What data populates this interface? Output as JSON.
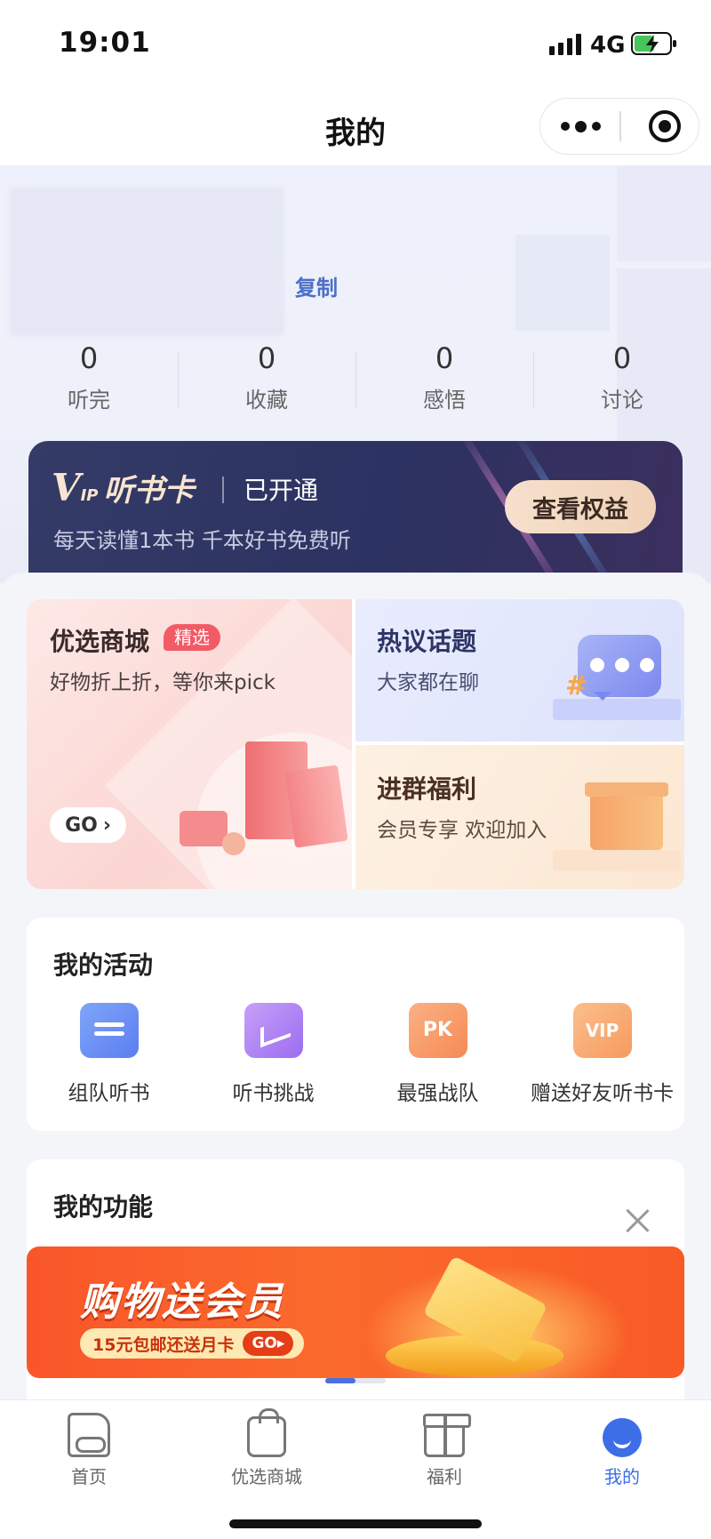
{
  "status_bar": {
    "time": "19:01",
    "network": "4G"
  },
  "nav": {
    "title": "我的"
  },
  "profile": {
    "copy_label": "复制",
    "stats": [
      {
        "value": "0",
        "label": "听完"
      },
      {
        "value": "0",
        "label": "收藏"
      },
      {
        "value": "0",
        "label": "感悟"
      },
      {
        "value": "0",
        "label": "讨论"
      }
    ]
  },
  "vip": {
    "logo_v": "V",
    "logo_ip": "IP",
    "title": "听书卡",
    "status": "已开通",
    "subtitle": "每天读懂1本书 千本好书免费听",
    "button": "查看权益"
  },
  "promos": {
    "mall": {
      "title": "优选商城",
      "badge": "精选",
      "subtitle": "好物折上折，等你来pick",
      "go": "GO"
    },
    "topic": {
      "title": "热议话题",
      "subtitle": "大家都在聊"
    },
    "welfare": {
      "title": "进群福利",
      "subtitle": "会员专享  欢迎加入"
    }
  },
  "activities": {
    "title": "我的活动",
    "items": [
      {
        "label": "组队听书",
        "icon": "team-book-icon"
      },
      {
        "label": "听书挑战",
        "icon": "challenge-chart-icon",
        "glyph": ""
      },
      {
        "label": "最强战队",
        "icon": "pk-icon",
        "glyph": "PK"
      },
      {
        "label": "赠送好友听书卡",
        "icon": "vip-card-icon",
        "glyph": "VIP"
      }
    ]
  },
  "functions": {
    "title": "我的功能",
    "banner": {
      "title": "购物送会员",
      "subtitle": "15元包邮还送月卡",
      "go": "GO"
    },
    "carousel_active": 0
  },
  "tab_bar": {
    "items": [
      {
        "label": "首页",
        "icon": "home-book-icon"
      },
      {
        "label": "优选商城",
        "icon": "shopping-bag-icon"
      },
      {
        "label": "福利",
        "icon": "gift-icon"
      },
      {
        "label": "我的",
        "icon": "profile-face-icon",
        "active": true
      }
    ]
  },
  "colors": {
    "accent": "#3d6ee7",
    "copy_link": "#4c6fc7",
    "vip_bg": "#2f3565",
    "banner": "#f9562a"
  }
}
